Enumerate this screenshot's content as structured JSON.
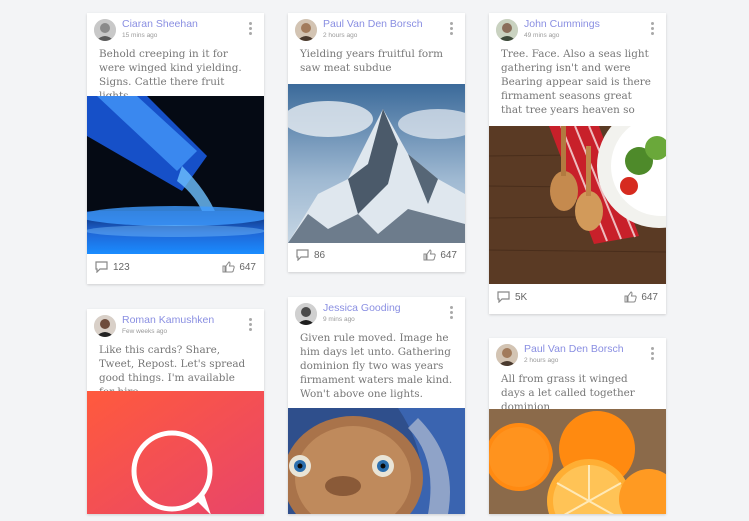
{
  "cards": [
    {
      "author": "Ciaran Sheehan",
      "time": "15 mins ago",
      "text": "Behold creeping in it for were winged kind yielding. Signs. Cattle there fruit lights.",
      "comments": "123",
      "likes": "647",
      "image": "water-bottle-pouring"
    },
    {
      "author": "Paul Van Den Borsch",
      "time": "2 hours ago",
      "text": "Yielding years fruitful form saw meat subdue",
      "comments": "86",
      "likes": "647",
      "image": "snowy-mountain"
    },
    {
      "author": "John Cummings",
      "time": "49 mins ago",
      "text": "Tree. Face. Also a seas light gathering isn't and were Bearing appear said is there firmament seasons great that tree years heaven so",
      "comments": "5K",
      "likes": "647",
      "image": "salad-and-wooden-spoons"
    },
    {
      "author": "Roman Kamushken",
      "time": "Few weeks ago",
      "text": "Like this cards? Share, Tweet, Repost. Let's spread good things. I'm available for hire",
      "image": "chat-bubble-gradient"
    },
    {
      "author": "Jessica Gooding",
      "time": "9 mins ago",
      "text": "Given rule moved. Image he him days let unto. Gathering dominion fly two was years firmament waters male kind. Won't above one lights.",
      "image": "et-alien"
    },
    {
      "author": "Paul Van Den Borsch",
      "time": "2 hours ago",
      "text": "All from grass it winged days a let called together dominion",
      "image": "oranges"
    }
  ],
  "colors": {
    "accent": "#8a8fe2",
    "background": "#f3f4f6"
  },
  "icons": [
    "more-vertical-icon",
    "comment-icon",
    "thumbs-up-icon"
  ]
}
